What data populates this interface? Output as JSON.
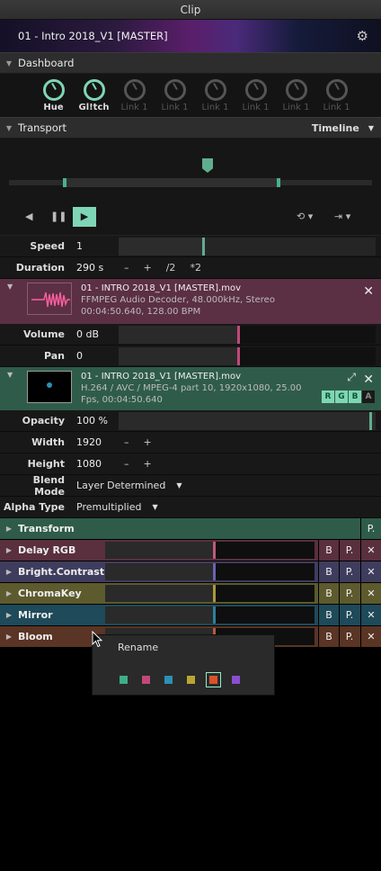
{
  "window": {
    "title": "Clip"
  },
  "header": {
    "title": "01 - Intro 2018_V1 [MASTER]",
    "gear_icon": "gear-icon"
  },
  "dashboard": {
    "label": "Dashboard",
    "knobs": [
      {
        "label": "Hue",
        "active": true
      },
      {
        "label": "Gl!tch",
        "active": true
      },
      {
        "label": "Link 1",
        "active": false
      },
      {
        "label": "Link 1",
        "active": false
      },
      {
        "label": "Link 1",
        "active": false
      },
      {
        "label": "Link 1",
        "active": false
      },
      {
        "label": "Link 1",
        "active": false
      },
      {
        "label": "Link 1",
        "active": false
      }
    ]
  },
  "transport": {
    "label": "Transport",
    "mode": "Timeline"
  },
  "speed": {
    "label": "Speed",
    "value": "1",
    "level": 0.3
  },
  "duration": {
    "label": "Duration",
    "value": "290 s",
    "minus": "–",
    "plus": "+",
    "div2": "/2",
    "mul2": "*2"
  },
  "audio": {
    "title": "01 - INTRO 2018_V1 [MASTER].mov",
    "info1": "FFMPEG Audio Decoder, 48.000kHz, Stereo",
    "info2": "00:04:50.640, 128.00 BPM"
  },
  "volume": {
    "label": "Volume",
    "value": "0 dB",
    "level": 0.48
  },
  "pan": {
    "label": "Pan",
    "value": "0",
    "level": 0.48
  },
  "video": {
    "title": "01 - INTRO 2018_V1 [MASTER].mov",
    "info1": "H.264 / AVC / MPEG-4 part 10, 1920x1080, 25.00",
    "info2": "Fps, 00:04:50.640",
    "channels": [
      "R",
      "G",
      "B",
      "A"
    ]
  },
  "opacity": {
    "label": "Opacity",
    "value": "100 %",
    "level": 1.0
  },
  "width": {
    "label": "Width",
    "value": "1920",
    "minus": "–",
    "plus": "+"
  },
  "height": {
    "label": "Height",
    "value": "1080",
    "minus": "–",
    "plus": "+"
  },
  "blend_mode": {
    "label": "Blend Mode",
    "value": "Layer Determined"
  },
  "alpha_type": {
    "label": "Alpha Type",
    "value": "Premultiplied"
  },
  "transform": {
    "label": "Transform",
    "p": "P."
  },
  "effects": [
    {
      "name": "Delay RGB",
      "bg": "#5a2f3e",
      "thumb": "#c05a7a",
      "b": "B",
      "p": "P."
    },
    {
      "name": "Bright.Contrast",
      "bg": "#3f3d5e",
      "thumb": "#6a63b0",
      "b": "B",
      "p": "P."
    },
    {
      "name": "ChromaKey",
      "bg": "#5d5a2e",
      "thumb": "#a89a3a",
      "b": "B",
      "p": "P."
    },
    {
      "name": "Mirror",
      "bg": "#1f4a5a",
      "thumb": "#2e7f9e",
      "b": "B",
      "p": "P."
    },
    {
      "name": "Bloom",
      "bg": "#5a3424",
      "thumb": "#b55a3a",
      "b": "B",
      "p": "P."
    }
  ],
  "context_menu": {
    "rename": "Rename",
    "swatches": [
      "#3eae85",
      "#c0497a",
      "#2d8fb5",
      "#b8a634",
      "#d9522a",
      "#8a4fd0"
    ]
  }
}
